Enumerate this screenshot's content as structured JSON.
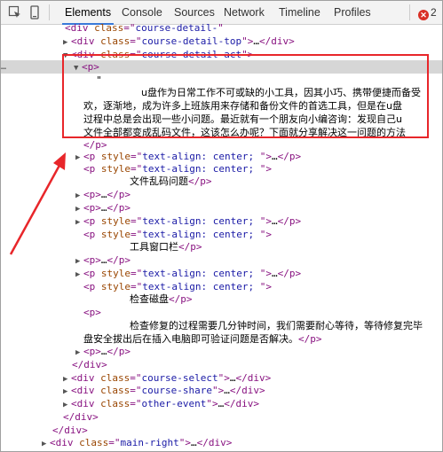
{
  "toolbar": {
    "tabs": [
      {
        "label": "Elements",
        "active": true
      },
      {
        "label": "Console",
        "active": false
      },
      {
        "label": "Sources",
        "active": false
      },
      {
        "label": "Network",
        "active": false
      },
      {
        "label": "Timeline",
        "active": false
      },
      {
        "label": "Profiles",
        "active": false
      }
    ],
    "error_count": "2"
  },
  "dom": {
    "l0": {
      "tag": "div",
      "attr": "class",
      "val": "course-detail-"
    },
    "l1": {
      "tag": "div",
      "attr": "class",
      "val": "course-detail-top",
      "ell": "…"
    },
    "l2": {
      "tag": "div",
      "attr": "class",
      "val": "course-detail-act"
    },
    "l3": {
      "tag": "p"
    },
    "l4": {
      "text": "\""
    },
    "l5": {
      "text": "u盘作为日常工作不可或缺的小工具，因其小巧、携带便捷而备受"
    },
    "l6": {
      "text": "欢，逐渐地，成为许多上班族用来存储和备份文件的首选工具，但是在u盘"
    },
    "l7": {
      "text": "过程中总是会出现一些小问题。最近就有一个朋友向小编咨询：发现自己u"
    },
    "l8": {
      "text": "文件全部都变成乱码文件，这该怎么办呢？下面就分享解决这一问题的方法"
    },
    "l9": {
      "tag": "p"
    },
    "l10": {
      "tag": "p",
      "attr": "style",
      "val": "text-align: center; ",
      "ell": "…"
    },
    "l11": {
      "tag": "p",
      "attr": "style",
      "val": "text-align: center; "
    },
    "l12": {
      "text": "文件乱码问题"
    },
    "l13": {
      "tag": "p",
      "ell": "…"
    },
    "l14": {
      "tag": "p",
      "ell": "…"
    },
    "l15": {
      "tag": "p",
      "attr": "style",
      "val": "text-align: center; ",
      "ell": "…"
    },
    "l16": {
      "tag": "p",
      "attr": "style",
      "val": "text-align: center; "
    },
    "l17": {
      "text": "工具窗口栏"
    },
    "l18": {
      "tag": "p",
      "ell": "…"
    },
    "l19": {
      "tag": "p",
      "attr": "style",
      "val": "text-align: center; ",
      "ell": "…"
    },
    "l20": {
      "tag": "p",
      "attr": "style",
      "val": "text-align: center; "
    },
    "l21": {
      "text": "检查磁盘"
    },
    "l22": {
      "tag": "p"
    },
    "l23": {
      "text": "检查修复的过程需要几分钟时间，我们需要耐心等待，等待修复完毕"
    },
    "l24": {
      "text": "盘安全拔出后在插入电脑即可验证问题是否解决。"
    },
    "l25": {
      "tag": "p",
      "ell": "…"
    },
    "l26": {
      "tag": "div"
    },
    "l27": {
      "tag": "div",
      "attr": "class",
      "val": "course-select",
      "ell": "…"
    },
    "l28": {
      "tag": "div",
      "attr": "class",
      "val": "course-share",
      "ell": "…"
    },
    "l29": {
      "tag": "div",
      "attr": "class",
      "val": "other-event",
      "ell": "…"
    },
    "l30": {
      "tag": "div"
    },
    "l31": {
      "tag": "div"
    },
    "l32": {
      "tag": "div",
      "attr": "class",
      "val": "main-right",
      "ell": "…"
    }
  },
  "colors": {
    "annotation": "#e8262a",
    "tag": "#881280",
    "attr": "#994500",
    "value": "#1a1aa6"
  }
}
